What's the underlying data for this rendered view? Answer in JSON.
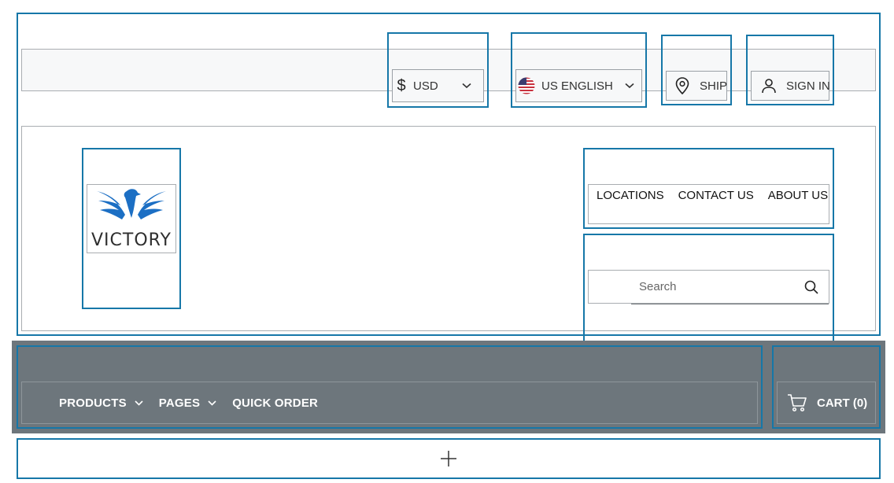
{
  "utility": {
    "currency": {
      "symbol": "$",
      "label": "USD"
    },
    "language": {
      "label": "US ENGLISH"
    },
    "ship": {
      "label": "SHIP"
    },
    "signin": {
      "label": "SIGN IN"
    }
  },
  "logo": {
    "text": "VICTORY",
    "color": "#1c6fc4"
  },
  "top_links": [
    "LOCATIONS",
    "CONTACT US",
    "ABOUT US"
  ],
  "search": {
    "placeholder": "Search"
  },
  "nav": {
    "items": [
      {
        "label": "PRODUCTS",
        "has_dropdown": true
      },
      {
        "label": "PAGES",
        "has_dropdown": true
      },
      {
        "label": "QUICK ORDER",
        "has_dropdown": false
      }
    ],
    "cart": {
      "label": "CART (0)"
    },
    "background": "#6d767c"
  },
  "add_section": {
    "icon": "plus-icon"
  },
  "colors": {
    "selection": "#1677a8",
    "utility_bg": "#f7f8f9"
  }
}
